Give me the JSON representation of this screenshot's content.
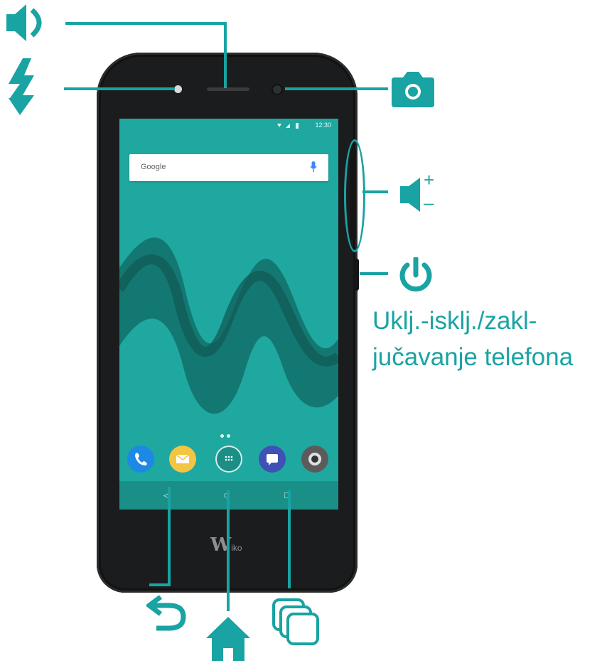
{
  "colors": {
    "accent": "#1aa3a3",
    "phone_body": "#1b1c1d",
    "screen_bg": "#1fa8a0",
    "navbar_bg": "#1a8f88"
  },
  "phone": {
    "status_time": "12:30",
    "search_bar": {
      "label": "Google",
      "icon": "mic-icon"
    },
    "page_indicator_count": 2,
    "dock_apps": [
      "phone-icon",
      "messages-icon",
      "app-drawer-icon",
      "chat-icon",
      "camera-app-icon"
    ],
    "nav_icons": [
      "back-icon",
      "home-icon",
      "recents-icon"
    ],
    "brand": {
      "initial": "W",
      "rest": "iko"
    }
  },
  "callouts": {
    "speaker": {
      "icon": "speaker-icon"
    },
    "flash": {
      "icon": "flash-icon"
    },
    "front_camera": {
      "icon": "camera-icon"
    },
    "volume": {
      "icon": "volume-icon",
      "plus": "+",
      "minus": "–"
    },
    "power": {
      "icon": "power-icon",
      "label_line1": "Uklj.-isklj./zakl-",
      "label_line2": "jučavanje telefona"
    },
    "back": {
      "icon": "back-arrow-icon"
    },
    "home": {
      "icon": "home-icon"
    },
    "recents": {
      "icon": "recent-apps-icon"
    }
  }
}
